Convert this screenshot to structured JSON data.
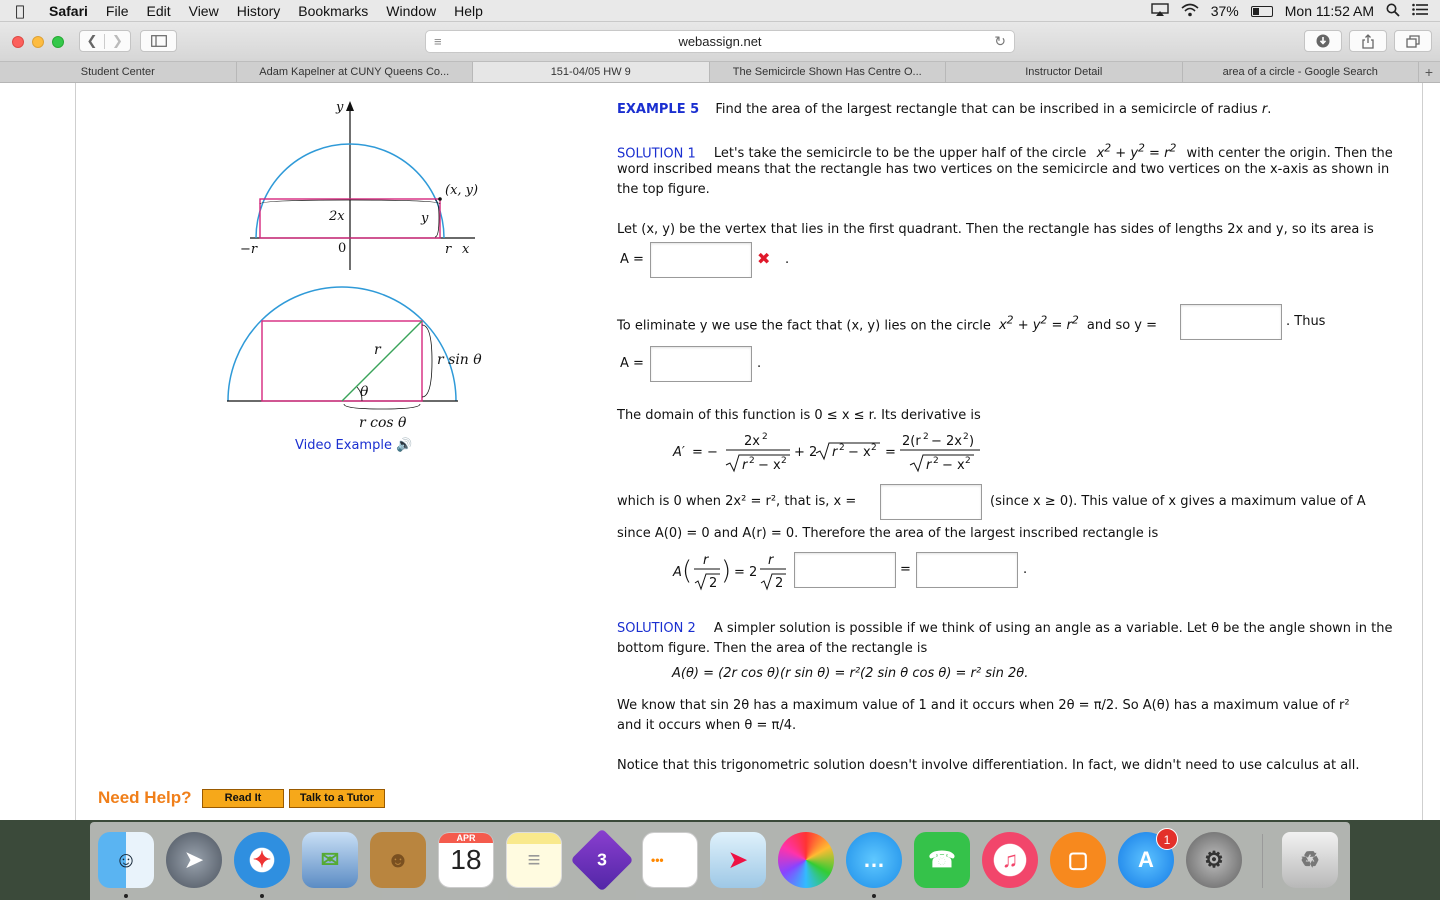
{
  "menubar": {
    "app": "Safari",
    "items": [
      "File",
      "Edit",
      "View",
      "History",
      "Bookmarks",
      "Window",
      "Help"
    ],
    "battery": "37%",
    "clock": "Mon 11:52 AM",
    "battery_level": 0.37
  },
  "toolbar": {
    "url": "webassign.net"
  },
  "tabs": [
    "Student Center",
    "Adam Kapelner at CUNY Queens Co...",
    "151-04/05 HW 9",
    "The Semicircle Shown Has Centre O...",
    "Instructor Detail",
    "area of a circle - Google Search"
  ],
  "active_tab_index": 2,
  "figure": {
    "top": {
      "y": "y",
      "x": "x",
      "neg_r": "−r",
      "zero": "0",
      "r": "r",
      "point": "(x, y)",
      "two_x": "2x",
      "y_side": "y"
    },
    "bottom": {
      "r": "r",
      "theta": "θ",
      "r_sin": "r sin θ",
      "r_cos": "r cos θ"
    },
    "video_label": "Video Example"
  },
  "example": {
    "label": "EXAMPLE 5",
    "prompt_pre": "Find the area of the largest rectangle that can be inscribed in a semicircle of radius ",
    "prompt_var": "r",
    "prompt_post": "."
  },
  "solution1": {
    "label": "SOLUTION 1",
    "l1_a": "Let's take the semicircle to be the upper half of the circle",
    "l1_b": "with center the origin. Then the",
    "l2": "word inscribed means that the rectangle has two vertices on the semicircle and two vertices on the x-axis as shown in",
    "l3": "the top figure.",
    "let_line": "Let  (x, y)  be the vertex that lies in the first quadrant. Then the rectangle has sides of lengths 2x and y, so its area is",
    "a_eq": "A =",
    "elim_a": "To eliminate y we use the fact that  (x, y)  lies on the circle",
    "elim_b": "and so  y =",
    "thus": ".  Thus",
    "a_eq2": "A =",
    "domain": "The domain of this function is  0 ≤ x ≤ r.  Its derivative is",
    "which_a": "which is 0 when  2x² = r²,  that is,  x =",
    "which_b": "(since  x ≥ 0).  This value of x gives a maximum value of A",
    "since": "since  A(0) = 0  and  A(r) = 0.  Therefore the area of the largest inscribed rectangle is"
  },
  "solution2": {
    "label": "SOLUTION 2",
    "l1": "A simpler solution is possible if we think of using an angle as a variable. Let θ be the angle shown in the",
    "l2": "bottom figure. Then the area of the rectangle is",
    "formula": "A(θ) = (2r cos θ)(r sin θ) = r²(2 sin θ cos θ) = r² sin 2θ.",
    "know1": "We know that  sin 2θ  has a maximum value of 1 and it occurs when  2θ = π/2.  So  A(θ)  has a maximum value of r²",
    "know2": "and it occurs when  θ = π/4.",
    "notice": "Notice that this trigonometric solution doesn't involve differentiation. In fact, we didn't need to use calculus at all."
  },
  "help": {
    "label": "Need Help?",
    "read_it": "Read It",
    "tutor": "Talk to a Tutor"
  },
  "dock": {
    "calendar_month": "APR",
    "calendar_day": "18",
    "appstore_badge": "1"
  }
}
